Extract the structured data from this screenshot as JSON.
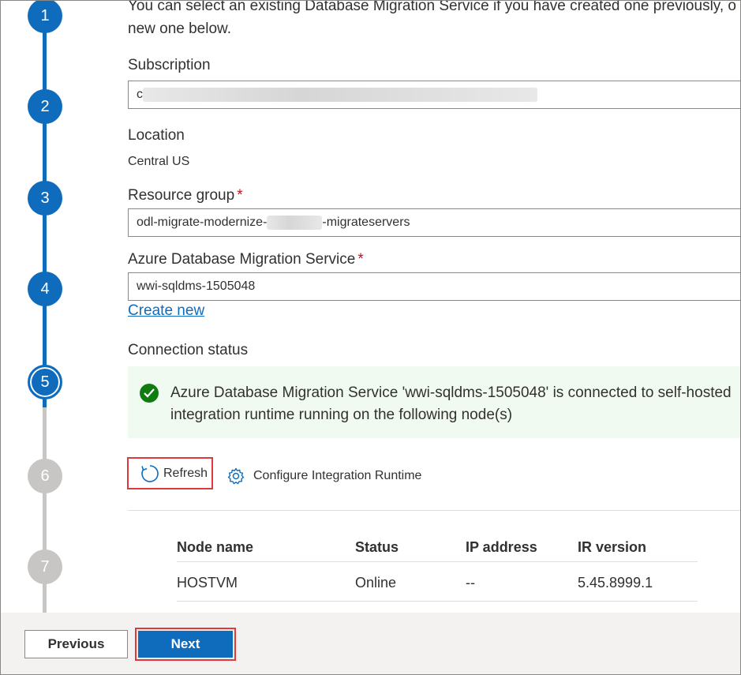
{
  "stepper": {
    "steps": [
      "1",
      "2",
      "3",
      "4",
      "5",
      "6",
      "7"
    ],
    "current": 5
  },
  "intro": {
    "line1": "You can select an existing Database Migration Service if you have created one previously, o",
    "line2": "new one below."
  },
  "subscription": {
    "label": "Subscription",
    "value_prefix": "c"
  },
  "location": {
    "label": "Location",
    "value": "Central US"
  },
  "resource_group": {
    "label": "Resource group",
    "required_mark": "*",
    "value_prefix": "odl-migrate-modernize-",
    "value_suffix": "-migrateservers"
  },
  "dms": {
    "label": "Azure Database Migration Service",
    "required_mark": "*",
    "value": "wwi-sqldms-1505048",
    "create_new": "Create new"
  },
  "connection": {
    "label": "Connection status",
    "message_line1": "Azure Database Migration Service 'wwi-sqldms-1505048' is connected to self-hosted",
    "message_line2": "integration runtime running on the following node(s)"
  },
  "actions": {
    "refresh": "Refresh",
    "configure": "Configure Integration Runtime"
  },
  "nodes_table": {
    "headers": [
      "Node name",
      "Status",
      "IP address",
      "IR version"
    ],
    "rows": [
      [
        "HOSTVM",
        "Online",
        "--",
        "5.45.8999.1"
      ]
    ]
  },
  "footer": {
    "previous": "Previous",
    "next": "Next"
  },
  "colors": {
    "accent": "#0f6cbd",
    "success": "#107c10",
    "highlight_border": "#e0393c",
    "step_todo": "#c8c6c4"
  }
}
